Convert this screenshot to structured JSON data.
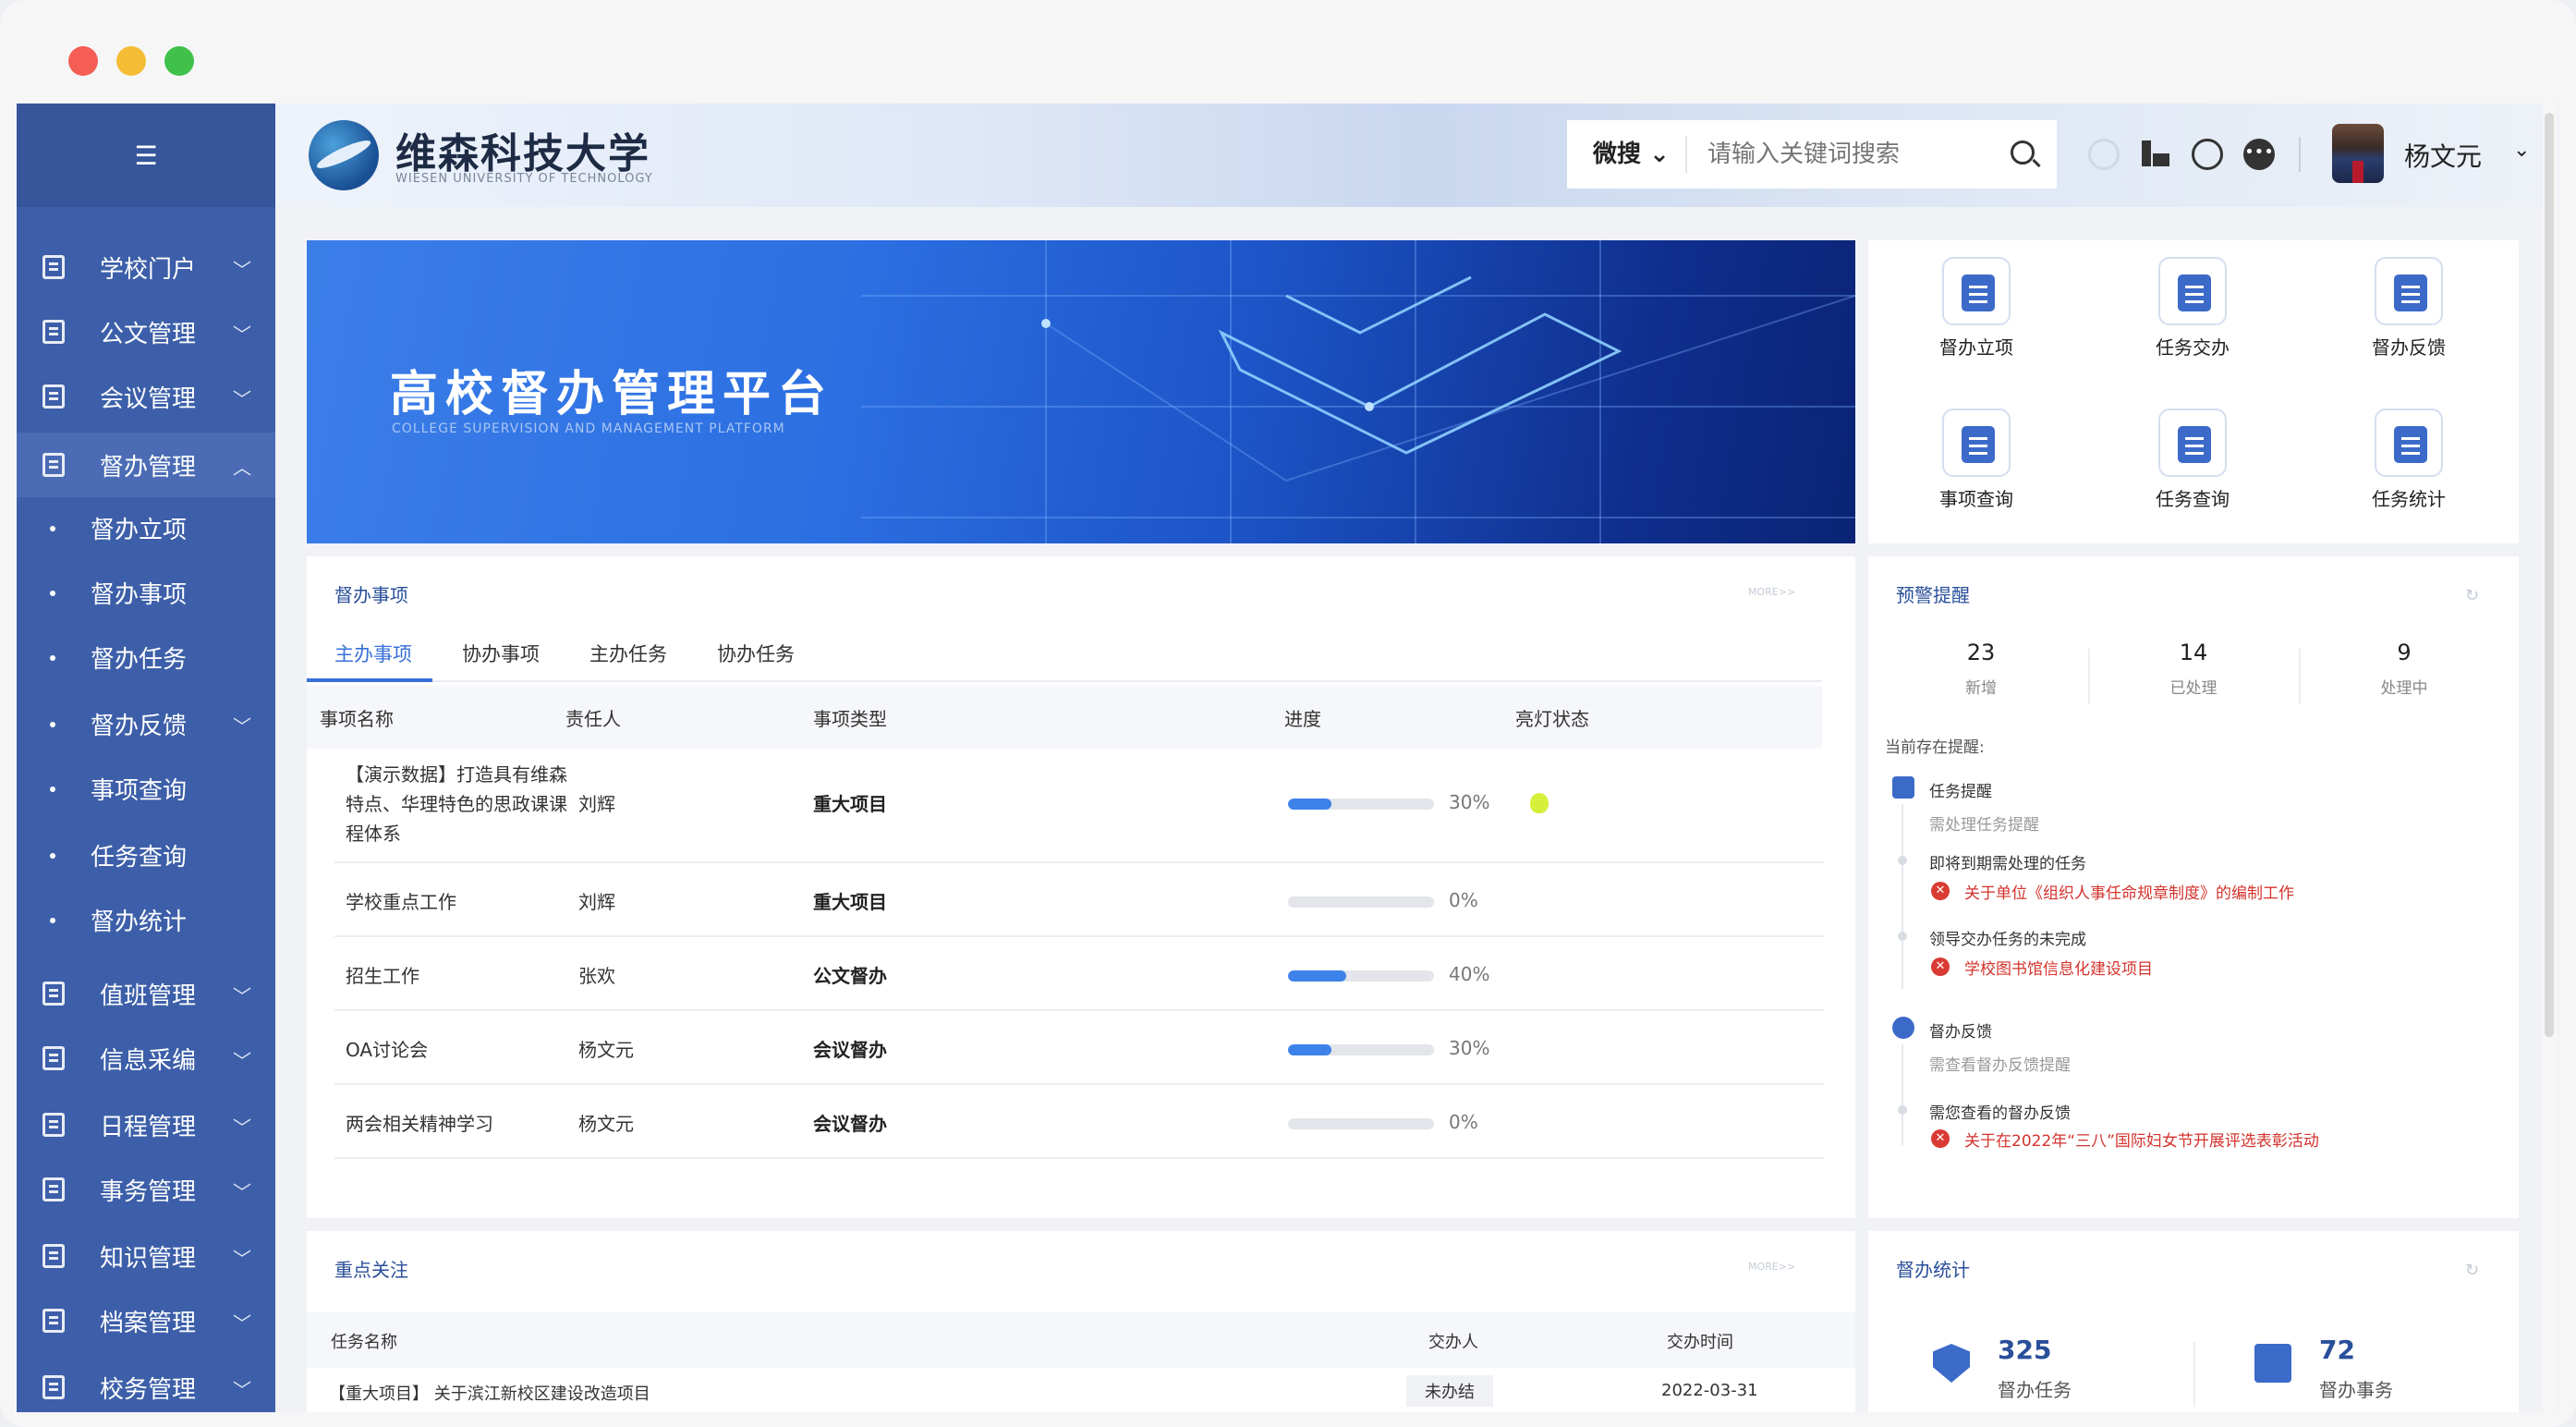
{
  "sidebar": {
    "toggle_icon": "☰",
    "items": [
      {
        "label": "学校门户",
        "icon": "doc-icon",
        "expanded": false
      },
      {
        "label": "公文管理",
        "icon": "doc-icon",
        "expanded": false
      },
      {
        "label": "会议管理",
        "icon": "doc-icon",
        "expanded": false
      },
      {
        "label": "督办管理",
        "icon": "doc-icon",
        "expanded": true
      },
      {
        "label": "值班管理",
        "icon": "doc-icon",
        "expanded": false
      },
      {
        "label": "信息采编",
        "icon": "bank-icon",
        "expanded": false
      },
      {
        "label": "日程管理",
        "icon": "calendar-icon",
        "expanded": false
      },
      {
        "label": "事务管理",
        "icon": "doc-icon",
        "expanded": false
      },
      {
        "label": "知识管理",
        "icon": "doc-icon",
        "expanded": false
      },
      {
        "label": "档案管理",
        "icon": "doc-icon",
        "expanded": false
      },
      {
        "label": "校务管理",
        "icon": "doc-icon",
        "expanded": false
      }
    ],
    "sub_items": [
      "督办立项",
      "督办事项",
      "督办任务",
      "督办反馈",
      "事项查询",
      "任务查询",
      "督办统计"
    ]
  },
  "header": {
    "logo_title": "维森科技大学",
    "logo_subtitle": "WIESEN UNIVERSITY OF TECHNOLOGY",
    "search_scope": "微搜",
    "search_placeholder": "请输入关键词搜索",
    "user_name": "杨文元"
  },
  "banner": {
    "title": "高校督办管理平台",
    "subtitle": "COLLEGE SUPERVISION AND MANAGEMENT PLATFORM"
  },
  "quick_actions": [
    {
      "label": "督办立项",
      "icon": "layers-icon"
    },
    {
      "label": "任务交办",
      "icon": "clipboard-icon"
    },
    {
      "label": "督办反馈",
      "icon": "edit-doc-icon"
    },
    {
      "label": "事项查询",
      "icon": "search-doc-icon"
    },
    {
      "label": "任务查询",
      "icon": "search-file-icon"
    },
    {
      "label": "任务统计",
      "icon": "bar-chart-icon"
    }
  ],
  "tasks": {
    "title": "督办事项",
    "more": "MORE>>",
    "tabs": [
      "主办事项",
      "协办事项",
      "主办任务",
      "协办任务"
    ],
    "columns": [
      "事项名称",
      "责任人",
      "事项类型",
      "进度",
      "亮灯状态"
    ],
    "rows": [
      {
        "name": "【演示数据】打造具有维森特点、华理特色的思政课课程体系",
        "owner": "刘辉",
        "type": "重大项目",
        "progress": 30,
        "progress_label": "30%",
        "light": true
      },
      {
        "name": "学校重点工作",
        "owner": "刘辉",
        "type": "重大项目",
        "progress": 0,
        "progress_label": "0%",
        "light": false
      },
      {
        "name": "招生工作",
        "owner": "张欢",
        "type": "公文督办",
        "progress": 40,
        "progress_label": "40%",
        "light": false
      },
      {
        "name": "OA讨论会",
        "owner": "杨文元",
        "type": "会议督办",
        "progress": 30,
        "progress_label": "30%",
        "light": false
      },
      {
        "name": "两会相关精神学习",
        "owner": "杨文元",
        "type": "会议督办",
        "progress": 0,
        "progress_label": "0%",
        "light": false
      }
    ]
  },
  "warnings": {
    "title": "预警提醒",
    "stats": [
      {
        "value": "23",
        "label": "新增"
      },
      {
        "value": "14",
        "label": "已处理"
      },
      {
        "value": "9",
        "label": "处理中"
      }
    ],
    "current_label": "当前存在提醒:",
    "task_reminder": {
      "title": "任务提醒",
      "subtitle": "需处理任务提醒",
      "groups": [
        {
          "heading": "即将到期需处理的任务",
          "item": "关于单位《组织人事任命规章制度》的编制工作"
        },
        {
          "heading": "领导交办任务的未完成",
          "item": "学校图书馆信息化建设项目"
        }
      ]
    },
    "feedback_reminder": {
      "title": "督办反馈",
      "subtitle": "需查看督办反馈提醒",
      "groups": [
        {
          "heading": "需您查看的督办反馈",
          "item": "关于在2022年“三八”国际妇女节开展评选表彰活动"
        }
      ]
    }
  },
  "focus": {
    "title": "重点关注",
    "more": "MORE>>",
    "columns": [
      "任务名称",
      "交办人",
      "交办时间"
    ],
    "rows": [
      {
        "name": "【重大项目】 关于滨江新校区建设改造项目",
        "status": "未办结",
        "date": "2022-03-31"
      }
    ]
  },
  "supervision_stats": {
    "title": "督办统计",
    "items": [
      {
        "value": "325",
        "label": "督办任务"
      },
      {
        "value": "72",
        "label": "督办事务"
      }
    ]
  },
  "colors": {
    "sidebar": "#3d5fa9",
    "accent": "#3870d8",
    "danger": "#d3332e"
  }
}
